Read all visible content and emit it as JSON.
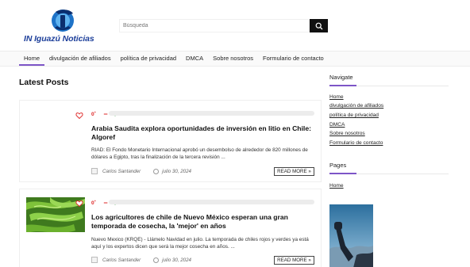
{
  "site": {
    "logo_text": "IN Iguazú Noticias",
    "accent_color": "#7d55c7"
  },
  "search": {
    "placeholder": "Búsqueda",
    "icon": "search-icon"
  },
  "nav": {
    "items": [
      {
        "label": "Home",
        "active": true
      },
      {
        "label": "divulgación de afiliados",
        "active": false
      },
      {
        "label": "política de privacidad",
        "active": false
      },
      {
        "label": "DMCA",
        "active": false
      },
      {
        "label": "Sobre nosotros",
        "active": false
      },
      {
        "label": "Formulario de contacto",
        "active": false
      }
    ]
  },
  "main": {
    "section_title": "Latest Posts",
    "posts": [
      {
        "votes": "0",
        "title": "Arabia Saudita explora oportunidades de inversión en litio en Chile: Algoref",
        "excerpt": "RIAD: El Fondo Monetario Internacional aprobó un desembolso de alrededor de 820 millones de dólares a Egipto, tras la finalización de la tercera revisión ...",
        "author": "Carlos Santander",
        "date": "julio 30, 2024",
        "read_more": "READ MORE »"
      },
      {
        "votes": "0",
        "title": "Los agricultores de chile de Nuevo México esperan una gran temporada de cosecha, la 'mejor' en años",
        "excerpt": "Nuevo Mexico (KRQE) - Llámelo Navidad en julio. La temporada de chiles rojos y verdes ya está aquí y los expertos dicen que será la mejor cosecha en años. ...",
        "author": "Carlos Santander",
        "date": "julio 30, 2024",
        "read_more": "READ MORE »"
      }
    ]
  },
  "sidebar": {
    "navigate": {
      "title": "Navigate",
      "links": [
        "Home",
        "divulgación de afiliados",
        "política de privacidad",
        "DMCA",
        "Sobre nosotros",
        "Formulario de contacto"
      ]
    },
    "pages": {
      "title": "Pages",
      "links": [
        "Home"
      ]
    }
  }
}
